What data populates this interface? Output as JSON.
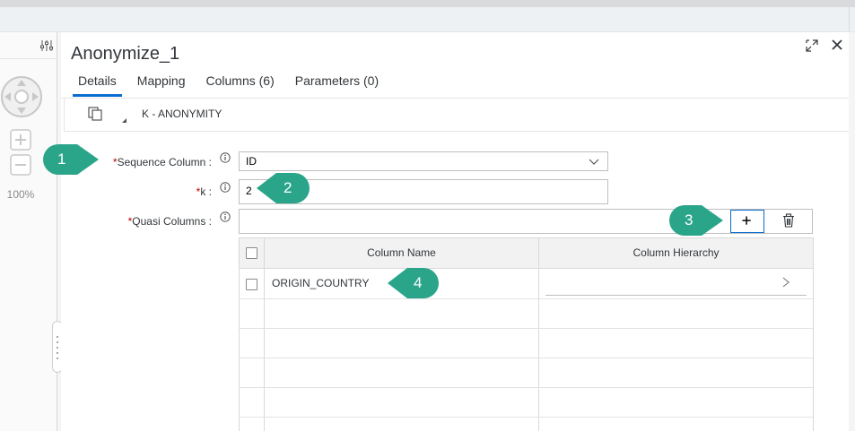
{
  "canvas": {
    "zoom_level": "100%"
  },
  "panel": {
    "title": "Anonymize_1",
    "tabs": [
      {
        "label": "Details",
        "active": true
      },
      {
        "label": "Mapping",
        "active": false
      },
      {
        "label": "Columns (6)",
        "active": false
      },
      {
        "label": "Parameters (0)",
        "active": false
      }
    ],
    "toolbar": {
      "node_type": "K - ANONYMITY"
    }
  },
  "form": {
    "sequence_column": {
      "label": "Sequence Column :",
      "value": "ID"
    },
    "k": {
      "label": "k :",
      "value": "2"
    },
    "quasi_columns": {
      "label": "Quasi Columns :"
    },
    "required_marker": "*"
  },
  "grid": {
    "headers": [
      "Column Name",
      "Column Hierarchy"
    ],
    "rows": [
      {
        "column_name": "ORIGIN_COUNTRY",
        "column_hierarchy": ""
      }
    ]
  },
  "callouts": [
    "1",
    "2",
    "3",
    "4"
  ],
  "colors": {
    "accent": "#0a6ed1",
    "callout": "#2aa58a",
    "required": "#bb0000"
  },
  "icons": [
    "settings-icon",
    "navigation-pad-icon",
    "zoom-in-icon",
    "zoom-out-icon",
    "expand-icon",
    "close-icon",
    "copy-icon",
    "info-icon",
    "chevron-down-icon",
    "add-icon",
    "delete-icon",
    "chevron-right-icon"
  ]
}
